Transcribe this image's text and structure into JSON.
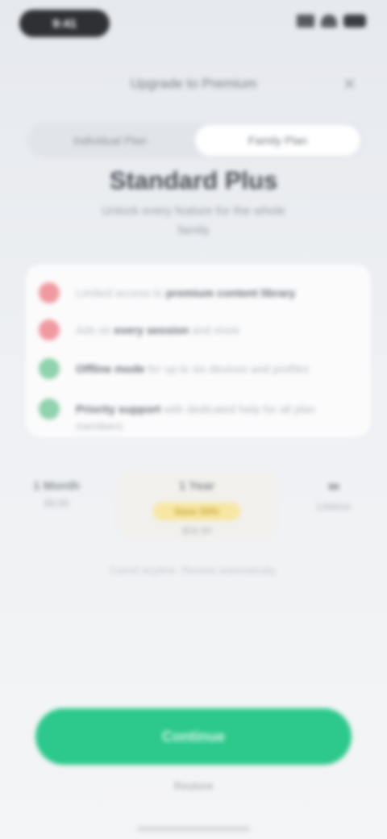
{
  "status_bar": {
    "time": "9:41"
  },
  "nav": {
    "title": "Upgrade to Premium",
    "close_icon": "close-icon",
    "close_glyph": "✕"
  },
  "tabs": [
    {
      "label": "Individual Plan",
      "active": false
    },
    {
      "label": "Family Plan",
      "active": true
    }
  ],
  "plan": {
    "title": "Standard Plus",
    "subtitle": "Unlock every feature for the whole family"
  },
  "features": [
    {
      "status": "no",
      "icon": "cross-icon",
      "prefix": "Limited access to",
      "bold": "premium content library",
      "suffix": ""
    },
    {
      "status": "no",
      "icon": "cross-icon",
      "prefix": "Ads on",
      "bold": "every session",
      "suffix": "and more"
    },
    {
      "status": "yes",
      "icon": "check-icon",
      "prefix": "",
      "bold": "Offline mode",
      "suffix": "for up to six devices and profiles"
    },
    {
      "status": "yes",
      "icon": "check-icon",
      "prefix": "",
      "bold": "Priority support",
      "suffix": "with dedicated help for all plan members"
    }
  ],
  "prices": [
    {
      "duration": "1 Month",
      "price": "$9.99"
    },
    {
      "duration": "1 Year",
      "price": "$59.99",
      "badge": "Save 50%"
    },
    {
      "duration": "∞",
      "price": "Lifetime"
    }
  ],
  "renew_note": "Cancel anytime. Renews automatically.",
  "cta": {
    "label": "Continue"
  },
  "restore": {
    "label": "Restore"
  },
  "colors": {
    "accent": "#2cc98a",
    "negative": "#f09aa0",
    "positive": "#8fd3ac",
    "badge": "#f7e7a2"
  }
}
